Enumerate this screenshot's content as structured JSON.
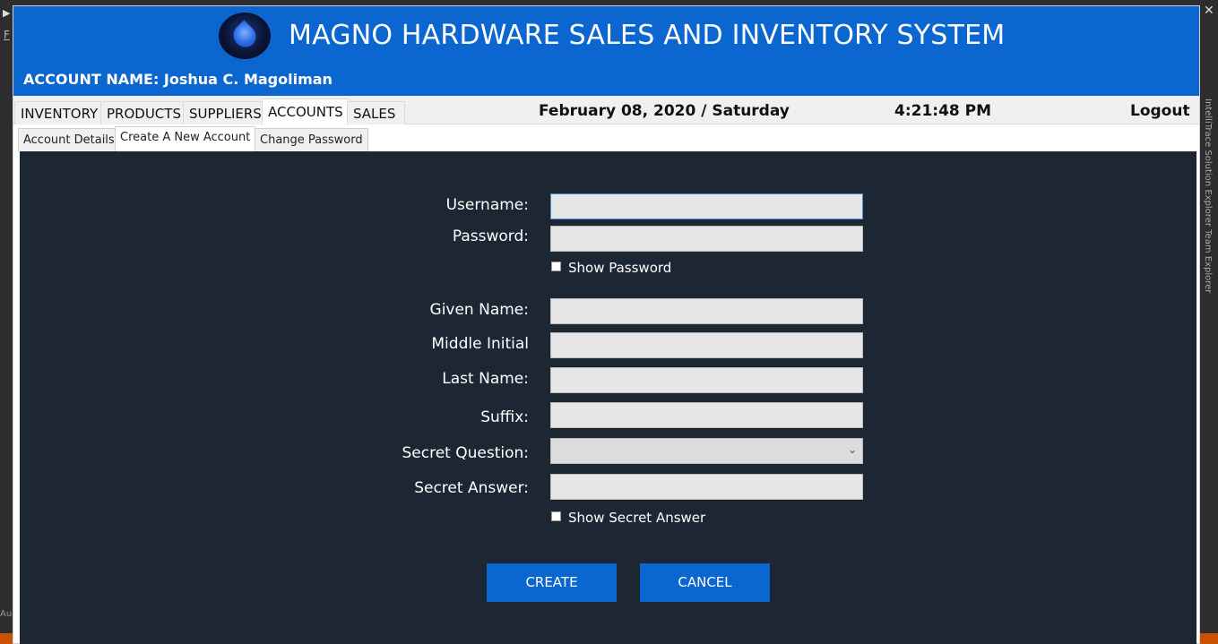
{
  "app": {
    "title": "MAGNO HARDWARE SALES AND INVENTORY SYSTEM",
    "account_label": "ACCOUNT NAME: Joshua C. Magoliman"
  },
  "nav": {
    "tabs": [
      {
        "label": "INVENTORY"
      },
      {
        "label": "PRODUCTS"
      },
      {
        "label": "SUPPLIERS"
      },
      {
        "label": "ACCOUNTS",
        "active": true
      },
      {
        "label": "SALES"
      }
    ],
    "date": "February 08, 2020 / Saturday",
    "time": "4:21:48 PM",
    "logout": "Logout"
  },
  "subnav": {
    "tabs": [
      {
        "label": "Account Details"
      },
      {
        "label": "Create A New Account",
        "active": true
      },
      {
        "label": "Change Password"
      }
    ]
  },
  "form": {
    "username_label": "Username:",
    "username_value": "",
    "password_label": "Password:",
    "password_value": "",
    "show_password_label": "Show Password",
    "show_password_checked": false,
    "given_name_label": "Given Name:",
    "given_name_value": "",
    "middle_initial_label": "Middle Initial",
    "middle_initial_value": "",
    "last_name_label": "Last Name:",
    "last_name_value": "",
    "suffix_label": "Suffix:",
    "suffix_value": "",
    "secret_question_label": "Secret Question:",
    "secret_question_value": "",
    "secret_answer_label": "Secret Answer:",
    "secret_answer_value": "",
    "show_secret_answer_label": "Show Secret Answer",
    "show_secret_answer_checked": false,
    "create_label": "CREATE",
    "cancel_label": "CANCEL"
  },
  "colors": {
    "header_blue": "#0c66d0",
    "panel_dark": "#1d2633",
    "input_bg": "#e6e6e6"
  },
  "ide": {
    "side_label": "IntelliTrace  Solution Explorer  Team Explorer",
    "left_f": "F",
    "left_au": "Au"
  }
}
